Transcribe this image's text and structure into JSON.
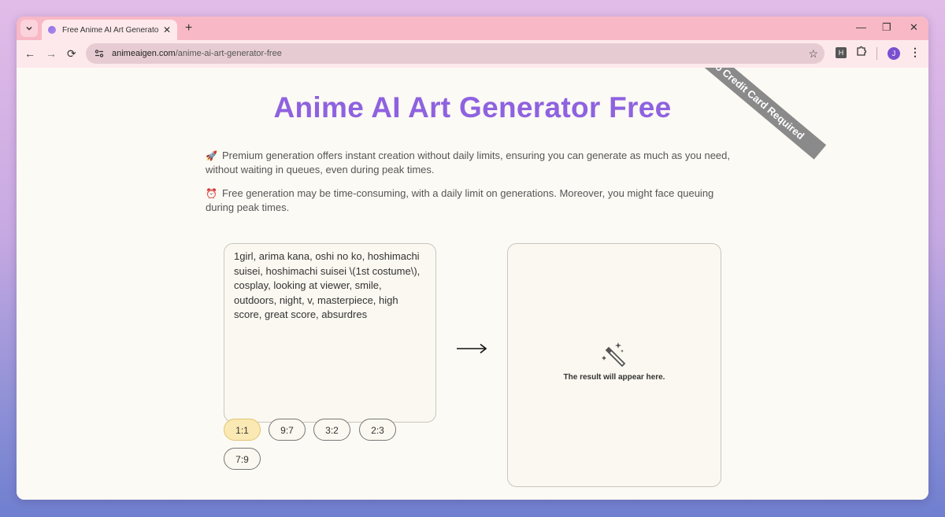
{
  "browser": {
    "tab_title": "Free Anime AI Art Generator - Create Anime Art",
    "new_tab": "+",
    "tab_close": "✕",
    "url_domain": "animeaigen.com",
    "url_path": "/anime-ai-art-generator-free",
    "profile_initial": "J",
    "extension_label": "H",
    "window_controls": {
      "minimize": "—",
      "restore": "❐",
      "close": "✕"
    }
  },
  "page": {
    "ribbon": "No Credit Card Required",
    "title": "Anime AI Art Generator Free",
    "premium_emoji": "🚀",
    "premium_text": "Premium generation offers instant creation without daily limits, ensuring you can generate as much as you need, without waiting in queues, even during peak times.",
    "free_emoji": "⏰",
    "free_text": "Free generation may be time-consuming, with a daily limit on generations. Moreover, you might face queuing during peak times.",
    "prompt_value": "1girl, arima kana, oshi no ko, hoshimachi suisei, hoshimachi suisei \\(1st costume\\), cosplay, looking at viewer, smile, outdoors, night, v, masterpiece, high score, great score, absurdres",
    "result_placeholder": "The result will appear here.",
    "aspect_ratios": [
      "1:1",
      "9:7",
      "3:2",
      "2:3",
      "7:9"
    ],
    "selected_ratio": "1:1"
  },
  "colors": {
    "accent": "#8e62e0",
    "tab_bar": "#f9b8c6",
    "selected_ratio_bg": "#fbe9b4"
  }
}
